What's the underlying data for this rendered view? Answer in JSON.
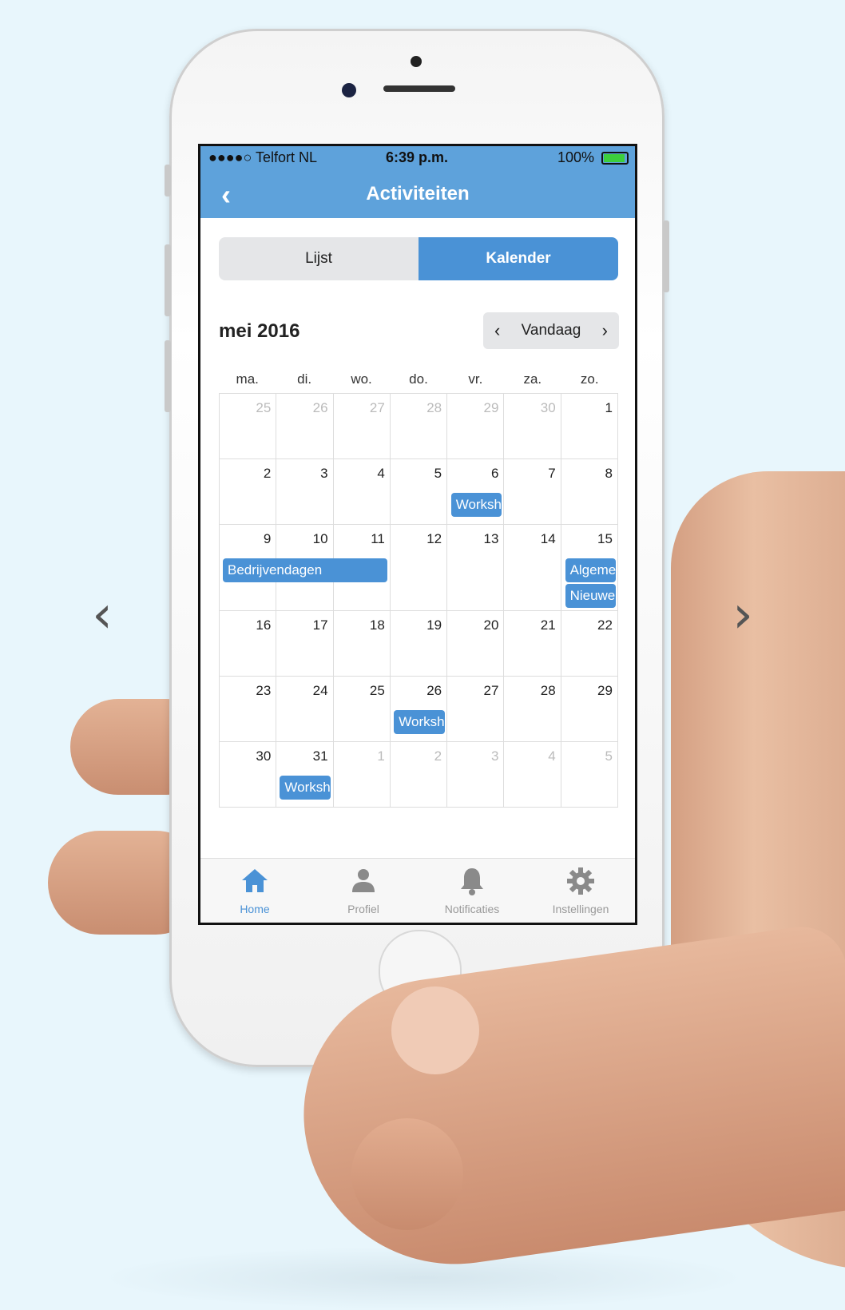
{
  "status_bar": {
    "carrier": "●●●●○ Telfort NL",
    "time": "6:39 p.m.",
    "battery": "100%",
    "battery_level": 1.0
  },
  "nav": {
    "title": "Activiteiten",
    "back_icon": "chevron-left-icon"
  },
  "segments": {
    "list": "Lijst",
    "calendar": "Kalender",
    "selected": "Kalender"
  },
  "calendar": {
    "month_title": "mei 2016",
    "today_label": "Vandaag",
    "weekdays": [
      "ma.",
      "di.",
      "wo.",
      "do.",
      "vr.",
      "za.",
      "zo."
    ],
    "weeks": [
      {
        "days": [
          {
            "n": "25",
            "dim": true
          },
          {
            "n": "26",
            "dim": true
          },
          {
            "n": "27",
            "dim": true
          },
          {
            "n": "28",
            "dim": true
          },
          {
            "n": "29",
            "dim": true
          },
          {
            "n": "30",
            "dim": true
          },
          {
            "n": "1",
            "dim": false
          }
        ],
        "events": []
      },
      {
        "days": [
          {
            "n": "2",
            "dim": false
          },
          {
            "n": "3",
            "dim": false
          },
          {
            "n": "4",
            "dim": false
          },
          {
            "n": "5",
            "dim": false
          },
          {
            "n": "6",
            "dim": false
          },
          {
            "n": "7",
            "dim": false
          },
          {
            "n": "8",
            "dim": false
          }
        ],
        "events": [
          {
            "label": "Worksh",
            "start": 4,
            "span": 1,
            "row": 0
          }
        ]
      },
      {
        "days": [
          {
            "n": "9",
            "dim": false
          },
          {
            "n": "10",
            "dim": false
          },
          {
            "n": "11",
            "dim": false
          },
          {
            "n": "12",
            "dim": false
          },
          {
            "n": "13",
            "dim": false
          },
          {
            "n": "14",
            "dim": false
          },
          {
            "n": "15",
            "dim": false
          }
        ],
        "events": [
          {
            "label": "Bedrijvendagen",
            "start": 0,
            "span": 3,
            "row": 0
          },
          {
            "label": "Algeme",
            "start": 6,
            "span": 1,
            "row": 0
          },
          {
            "label": "Nieuwe",
            "start": 6,
            "span": 1,
            "row": 1
          }
        ]
      },
      {
        "days": [
          {
            "n": "16",
            "dim": false
          },
          {
            "n": "17",
            "dim": false
          },
          {
            "n": "18",
            "dim": false
          },
          {
            "n": "19",
            "dim": false
          },
          {
            "n": "20",
            "dim": false
          },
          {
            "n": "21",
            "dim": false
          },
          {
            "n": "22",
            "dim": false
          }
        ],
        "events": []
      },
      {
        "days": [
          {
            "n": "23",
            "dim": false
          },
          {
            "n": "24",
            "dim": false
          },
          {
            "n": "25",
            "dim": false
          },
          {
            "n": "26",
            "dim": false
          },
          {
            "n": "27",
            "dim": false
          },
          {
            "n": "28",
            "dim": false
          },
          {
            "n": "29",
            "dim": false
          }
        ],
        "events": [
          {
            "label": "Worksh",
            "start": 3,
            "span": 1,
            "row": 0
          }
        ]
      },
      {
        "days": [
          {
            "n": "30",
            "dim": false
          },
          {
            "n": "31",
            "dim": false
          },
          {
            "n": "1",
            "dim": true
          },
          {
            "n": "2",
            "dim": true
          },
          {
            "n": "3",
            "dim": true
          },
          {
            "n": "4",
            "dim": true
          },
          {
            "n": "5",
            "dim": true
          }
        ],
        "events": [
          {
            "label": "Worksh",
            "start": 1,
            "span": 1,
            "row": 0
          }
        ]
      }
    ]
  },
  "tabbar": {
    "items": [
      {
        "label": "Home",
        "icon": "home-icon",
        "active": true
      },
      {
        "label": "Profiel",
        "icon": "profile-icon",
        "active": false
      },
      {
        "label": "Notificaties",
        "icon": "bell-icon",
        "active": false
      },
      {
        "label": "Instellingen",
        "icon": "gear-icon",
        "active": false
      }
    ]
  },
  "colors": {
    "accent": "#4a92d6",
    "header": "#5ea2db",
    "background": "#e8f6fc"
  }
}
